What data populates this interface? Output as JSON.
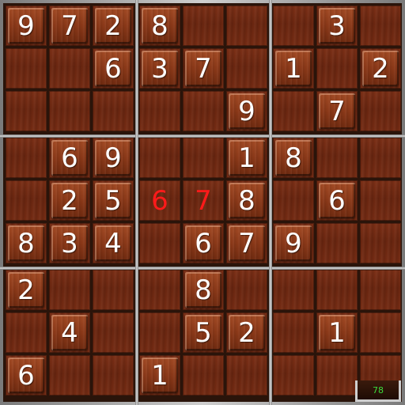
{
  "game": {
    "name": "sudoku",
    "counter": "78",
    "colors": {
      "given": "#ffffff",
      "user_entry": "#ff1a1a",
      "counter": "#3cdc3c"
    },
    "grid": [
      [
        "9",
        "7",
        "2",
        "8",
        "",
        "",
        "",
        "3",
        ""
      ],
      [
        "",
        "",
        "6",
        "3",
        "7",
        "",
        "1",
        "",
        "2"
      ],
      [
        "",
        "",
        "",
        "",
        "",
        "9",
        "",
        "7",
        ""
      ],
      [
        "",
        "6",
        "9",
        "",
        "",
        "1",
        "8",
        "",
        ""
      ],
      [
        "",
        "2",
        "5",
        "6",
        "7",
        "8",
        "",
        "6",
        ""
      ],
      [
        "8",
        "3",
        "4",
        "",
        "6",
        "7",
        "9",
        "",
        ""
      ],
      [
        "2",
        "",
        "",
        "",
        "8",
        "",
        "",
        "",
        ""
      ],
      [
        "",
        "4",
        "",
        "",
        "5",
        "2",
        "",
        "1",
        ""
      ],
      [
        "6",
        "",
        "",
        "1",
        "",
        "",
        "",
        "",
        ""
      ]
    ],
    "user_entries": [
      [
        4,
        3
      ],
      [
        4,
        4
      ]
    ]
  }
}
